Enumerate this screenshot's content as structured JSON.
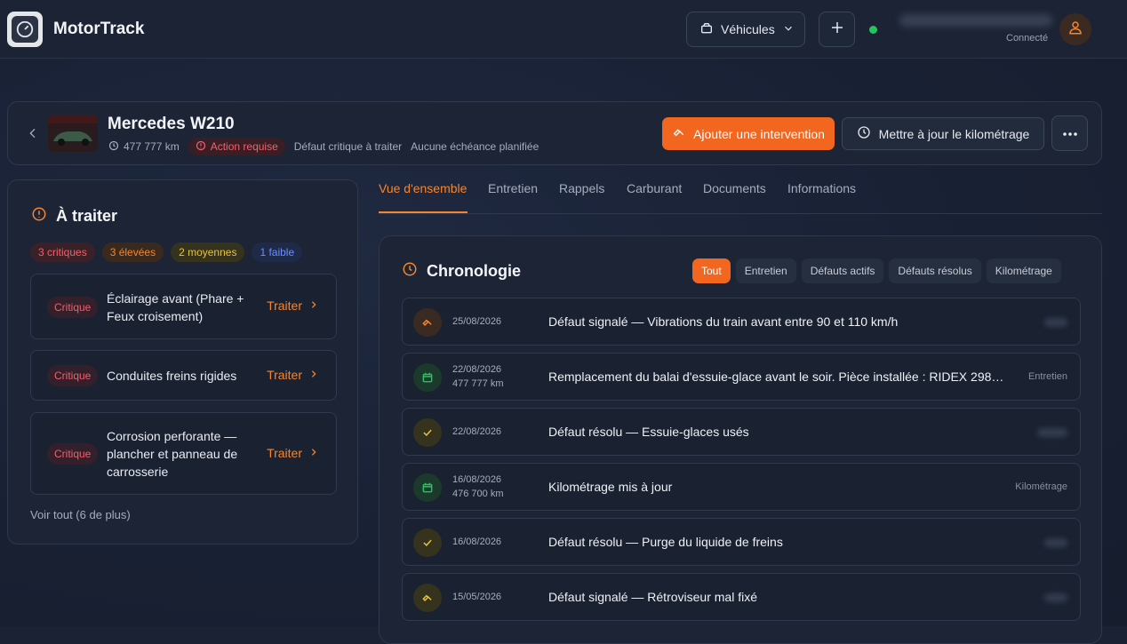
{
  "app": {
    "name": "MotorTrack"
  },
  "header": {
    "vehicles_label": "Véhicules",
    "status_label": "Connecté"
  },
  "vehicle": {
    "name": "Mercedes W210",
    "mileage": "477 777 km",
    "action_badge": "Action requise",
    "meta_1": "Défaut critique à traiter",
    "meta_2": "Aucune échéance planifiée",
    "add_intervention": "Ajouter une intervention",
    "update_mileage": "Mettre à jour le kilométrage"
  },
  "todo": {
    "title": "À traiter",
    "pills": {
      "critical": "3 critiques",
      "high": "3 élevées",
      "medium": "2 moyennes",
      "low": "1 faible"
    },
    "items": [
      {
        "severity": "Critique",
        "text": "Éclairage avant (Phare + Feux croisement)",
        "action": "Traiter"
      },
      {
        "severity": "Critique",
        "text": "Conduites freins rigides",
        "action": "Traiter"
      },
      {
        "severity": "Critique",
        "text": "Corrosion perforante — plancher et panneau de carrosserie",
        "action": "Traiter"
      }
    ],
    "see_all": "Voir tout (6 de plus)"
  },
  "tabs": [
    "Vue d'ensemble",
    "Entretien",
    "Rappels",
    "Carburant",
    "Documents",
    "Informations"
  ],
  "timeline": {
    "title": "Chronologie",
    "filters": [
      "Tout",
      "Entretien",
      "Défauts actifs",
      "Défauts résolus",
      "Kilométrage"
    ],
    "rows": [
      {
        "icon": "wrench-icon",
        "date": "25/08/2026",
        "km": "",
        "text": "Défaut signalé — Vibrations du train avant entre 90 et 110 km/h",
        "tag": ""
      },
      {
        "icon": "calendar-icon",
        "date": "22/08/2026",
        "km": "477 777 km",
        "text": "Remplacement du balai d'essuie-glace avant le soir. Pièce installée : RIDEX 298…",
        "tag": "Entretien"
      },
      {
        "icon": "check-icon",
        "date": "22/08/2026",
        "km": "",
        "text": "Défaut résolu — Essuie-glaces usés",
        "tag": ""
      },
      {
        "icon": "calendar-icon",
        "date": "16/08/2026",
        "km": "476 700 km",
        "text": "Kilométrage mis à jour",
        "tag": "Kilométrage"
      },
      {
        "icon": "check-icon",
        "date": "16/08/2026",
        "km": "",
        "text": "Défaut résolu — Purge du liquide de freins",
        "tag": ""
      },
      {
        "icon": "wrench-icon",
        "date": "15/05/2026",
        "km": "",
        "text": "Défaut signalé — Rétroviseur mal fixé",
        "tag": ""
      }
    ]
  },
  "colors": {
    "accent": "#f2661f",
    "critical": "#f0616d",
    "success": "#22c55e"
  }
}
